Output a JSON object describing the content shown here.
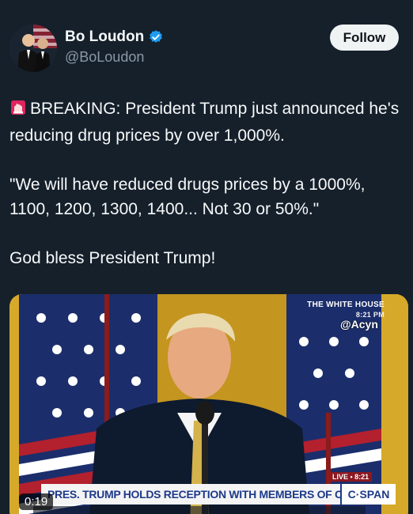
{
  "author": {
    "display_name": "Bo Loudon",
    "handle": "@BoLoudon",
    "verified": true,
    "verified_color": "#1d9bf0"
  },
  "follow_button": {
    "label": "Follow"
  },
  "tweet": {
    "siren_icon": "rotating-light-icon",
    "line1": "BREAKING: President Trump just announced he's reducing drug prices by over 1,000%.",
    "line2": "\"We will have reduced drugs prices by a 1000%, 1100, 1200, 1300, 1400... Not 30 or 50%.\"",
    "line3": "God bless President Trump!"
  },
  "video": {
    "network_badge": "THE WHITE HOUSE",
    "network_time": "8:21 PM",
    "watermark": "@Acyn",
    "chyron": "PRES. TRUMP HOLDS RECEPTION WITH MEMBERS OF CONGRESS",
    "chyron_network": "C·SPAN",
    "live_label": "LIVE • 8:21",
    "duration": "0:19"
  },
  "colors": {
    "background": "#15202b",
    "text_primary": "#f7f9f9",
    "text_secondary": "#8b98a5",
    "follow_bg": "#eff3f4"
  }
}
